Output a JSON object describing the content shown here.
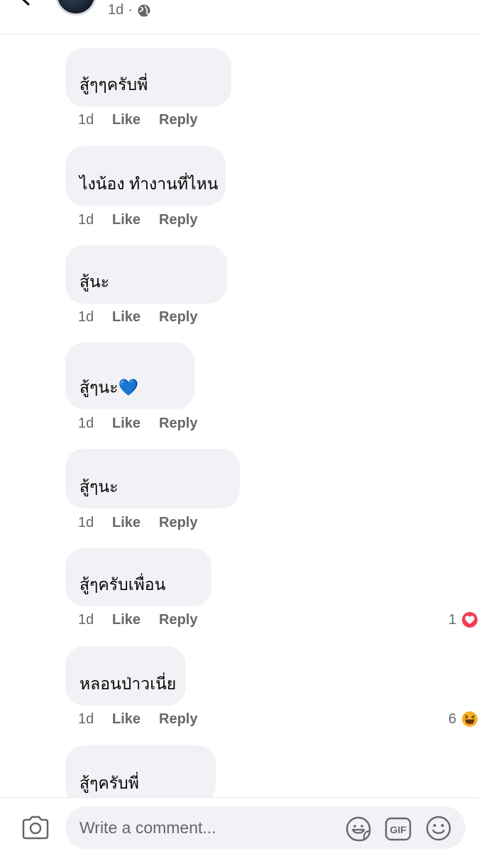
{
  "post": {
    "time": "1d",
    "audience_icon": "globe-icon"
  },
  "comments": [
    {
      "text": "สู้ๆๆครับพี่",
      "time": "1d",
      "like": "Like",
      "reply": "Reply"
    },
    {
      "text": "ไงน้อง ทำงานที่ไหน",
      "time": "1d",
      "like": "Like",
      "reply": "Reply"
    },
    {
      "text": "สู้นะ",
      "time": "1d",
      "like": "Like",
      "reply": "Reply"
    },
    {
      "text": "สู้ๆนะ💙",
      "time": "1d",
      "like": "Like",
      "reply": "Reply"
    },
    {
      "text": "สู้ๆนะ",
      "time": "1d",
      "like": "Like",
      "reply": "Reply"
    },
    {
      "text": "สู้ๆครับเพื่อน",
      "time": "1d",
      "like": "Like",
      "reply": "Reply",
      "reaction_count": "1",
      "reaction_icon": "love-reaction-icon"
    },
    {
      "text": "หลอนป่าวเนี่ย",
      "time": "1d",
      "like": "Like",
      "reply": "Reply",
      "reaction_count": "6",
      "reaction_icon": "haha-reaction-icon"
    },
    {
      "text": "สู้ๆครับพี่"
    }
  ],
  "composer": {
    "placeholder": "Write a comment...",
    "icons": [
      "camera-icon",
      "sticker-icon",
      "gif-icon",
      "emoji-icon"
    ]
  },
  "colors": {
    "bubble_bg": "#f0f2f5",
    "meta_text": "#65676b",
    "love_red": "#f33e58",
    "haha_yellow": "#f7b125"
  }
}
